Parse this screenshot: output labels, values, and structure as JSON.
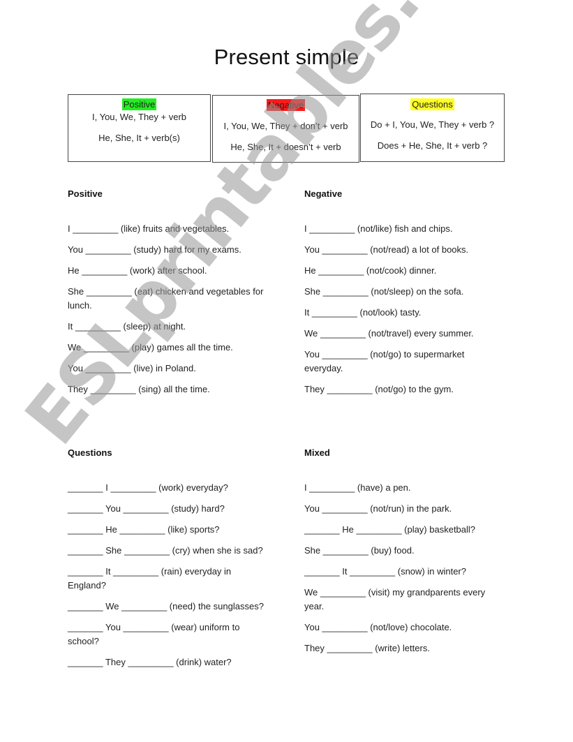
{
  "title": "Present simple",
  "rules": {
    "positive": {
      "label": "Positive",
      "highlight": "#22ee22",
      "lines": [
        "I, You, We, They + verb",
        "He, She, It + verb(s)"
      ]
    },
    "negative": {
      "label": "Negative",
      "highlight": "#ff1a1a",
      "lines": [
        "I, You, We, They + don’t + verb",
        "He, She, It + doesn’t + verb"
      ]
    },
    "questions": {
      "label": "Questions",
      "highlight": "#ffff22",
      "lines": [
        "Do + I, You, We, They + verb ?",
        "Does + He, She, It + verb ?"
      ]
    }
  },
  "sections": {
    "positive": {
      "heading": "Positive",
      "items": [
        "I _________ (like) fruits and vegetables.",
        "You _________ (study) hard for my exams.",
        "He _________ (work) after school.",
        "She _________ (eat) chicken and vegetables for lunch.",
        "It _________ (sleep) at night.",
        "We _________ (play) games all the time.",
        "You _________ (live) in Poland.",
        "They _________ (sing) all the time."
      ]
    },
    "negative": {
      "heading": "Negative",
      "items": [
        "I _________ (not/like) fish and chips.",
        "You _________ (not/read) a lot of books.",
        "He _________ (not/cook) dinner.",
        "She _________ (not/sleep) on the sofa.",
        "It _________ (not/look) tasty.",
        "We _________ (not/travel) every summer.",
        "You _________ (not/go) to supermarket everyday.",
        "They _________ (not/go) to the gym."
      ]
    },
    "questions": {
      "heading": "Questions",
      "items": [
        "_______ I _________ (work) everyday?",
        "_______ You _________ (study) hard?",
        "_______ He _________ (like) sports?",
        "_______ She _________ (cry) when she is sad?",
        "_______ It _________ (rain) everyday in England?",
        "_______ We _________ (need) the sunglasses?",
        "_______ You _________ (wear) uniform to school?",
        "_______ They _________  (drink) water?"
      ]
    },
    "mixed": {
      "heading": "Mixed",
      "items": [
        "I _________ (have) a pen.",
        "You _________ (not/run) in the park.",
        "_______ He _________ (play) basketball?",
        "She _________ (buy) food.",
        "_______ It _________ (snow) in winter?",
        "We _________ (visit) my grandparents every year.",
        "You _________ (not/love) chocolate.",
        "They _________ (write) letters."
      ]
    }
  },
  "watermark": "ESLprintables.com"
}
